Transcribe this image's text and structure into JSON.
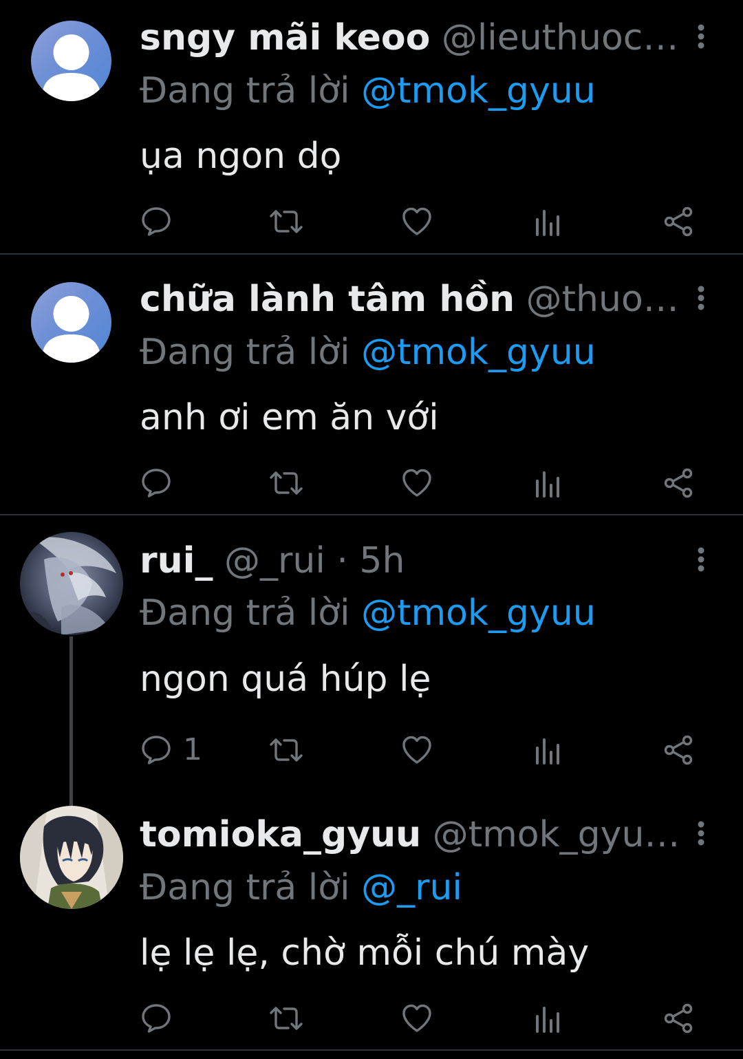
{
  "tweets": [
    {
      "display_name": "sngy mãi keoo",
      "handle": "@lieuthuoc…",
      "time": "",
      "reply_prefix": "Đang trả lời",
      "reply_to": "@tmok_gyuu",
      "text": "ụa ngon dọ",
      "reply_count": ""
    },
    {
      "display_name": "chữa lành tâm hồn",
      "handle": "@thuo…",
      "time": "",
      "reply_prefix": "Đang trả lời",
      "reply_to": "@tmok_gyuu",
      "text": "anh ơi em ăn với",
      "reply_count": ""
    },
    {
      "display_name": "rui_",
      "handle": "@_rui",
      "time": "5h",
      "separator": "·",
      "reply_prefix": "Đang trả lời",
      "reply_to": "@tmok_gyuu",
      "text": "ngon quá húp lẹ",
      "reply_count": "1"
    },
    {
      "display_name": "tomioka_gyuu",
      "handle": "@tmok_gyu…",
      "time": "",
      "reply_prefix": "Đang trả lời",
      "reply_to": "@_rui",
      "text": "lẹ lẹ lẹ, chờ mỗi chú mày",
      "reply_count": ""
    }
  ],
  "colors": {
    "background": "#000000",
    "text_primary": "#e7e9ea",
    "text_secondary": "#71767b",
    "link": "#1d9bf0",
    "divider": "#2f3336",
    "default_avatar": "#6d8fd6"
  },
  "icons": {
    "reply": "speech-bubble-icon",
    "retweet": "retweet-icon",
    "like": "heart-icon",
    "views": "bar-chart-icon",
    "share": "share-icon",
    "more": "vertical-dots-icon"
  }
}
